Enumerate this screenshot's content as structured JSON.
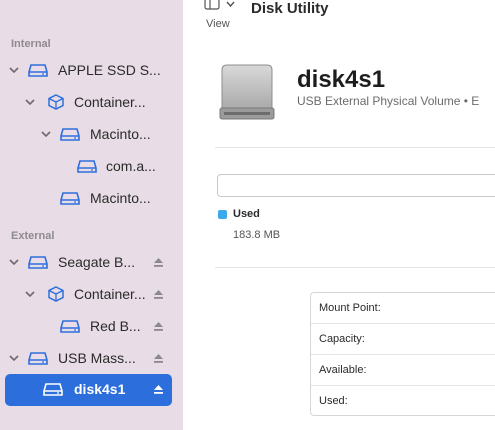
{
  "toolbar": {
    "view_label": "View",
    "app_title": "Disk Utility"
  },
  "sidebar": {
    "sections": [
      {
        "label": "Internal",
        "items": [
          {
            "label": "APPLE SSD S...",
            "icon": "internal-disk-icon",
            "expanded": true
          },
          {
            "label": "Container...",
            "icon": "container-icon",
            "expanded": true
          },
          {
            "label": "Macinto...",
            "icon": "volume-icon",
            "expanded": true
          },
          {
            "label": "com.a...",
            "icon": "volume-icon"
          },
          {
            "label": "Macinto...",
            "icon": "volume-icon"
          }
        ]
      },
      {
        "label": "External",
        "items": [
          {
            "label": "Seagate B...",
            "icon": "external-disk-icon",
            "expanded": true,
            "eject": true
          },
          {
            "label": "Container...",
            "icon": "container-icon",
            "expanded": true,
            "eject": true
          },
          {
            "label": "Red B...",
            "icon": "volume-icon",
            "eject": true
          },
          {
            "label": "USB Mass...",
            "icon": "external-disk-icon",
            "expanded": true,
            "eject": true
          },
          {
            "label": "disk4s1",
            "icon": "volume-icon",
            "eject": true,
            "selected": true
          }
        ]
      }
    ]
  },
  "volume": {
    "name": "disk4s1",
    "description": "USB External Physical Volume • E"
  },
  "usage": {
    "used_label": "Used",
    "used_value": "183.8 MB",
    "used_color": "#3ea9e8"
  },
  "info": {
    "rows": [
      {
        "key": "Mount Point:"
      },
      {
        "key": "Capacity:"
      },
      {
        "key": "Available:"
      },
      {
        "key": "Used:"
      }
    ]
  },
  "colors": {
    "sidebar_bg": "#e8dde6",
    "selection": "#2c6fdc"
  }
}
